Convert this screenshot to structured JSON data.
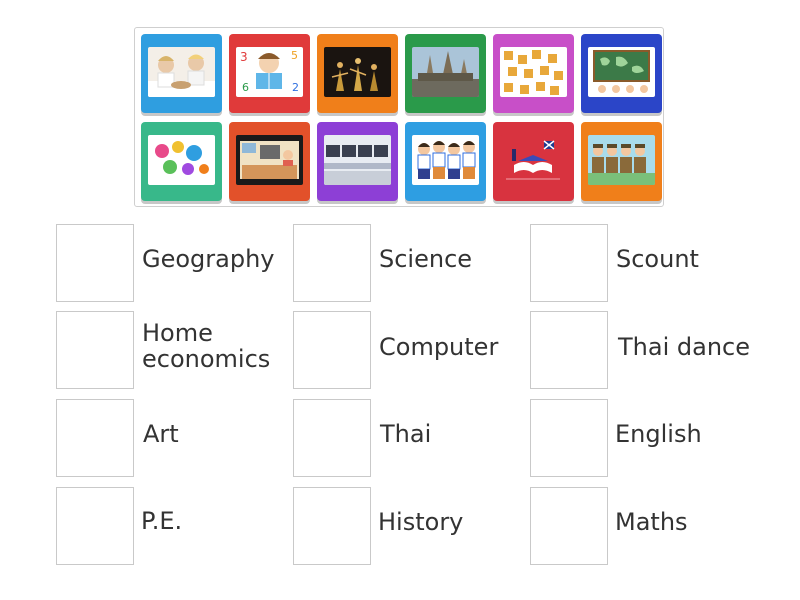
{
  "tiles": [
    {
      "icon": "children-cooking-icon",
      "color": "#2f9ee0"
    },
    {
      "icon": "child-reading-numbers-icon",
      "color": "#e03a3a"
    },
    {
      "icon": "thai-dancers-stage-icon",
      "color": "#f07f1a"
    },
    {
      "icon": "ancient-temple-ruins-icon",
      "color": "#2a9a4a"
    },
    {
      "icon": "scrabble-letters-icon",
      "color": "#c84fc8"
    },
    {
      "icon": "world-map-classroom-icon",
      "color": "#2b45c8"
    },
    {
      "icon": "paint-splash-icon",
      "color": "#38b88a"
    },
    {
      "icon": "kitchen-cartoon-icon",
      "color": "#e2512a"
    },
    {
      "icon": "computer-lab-icon",
      "color": "#8d3fd6"
    },
    {
      "icon": "thai-students-icon",
      "color": "#2e9ee2"
    },
    {
      "icon": "english-book-icon",
      "color": "#d8333f"
    },
    {
      "icon": "scouts-icon",
      "color": "#f07f1a"
    }
  ],
  "targets": [
    {
      "label": "Geography"
    },
    {
      "label": "Science"
    },
    {
      "label": "Scount"
    },
    {
      "label": "Home\neconomics"
    },
    {
      "label": "Computer"
    },
    {
      "label": "Thai dance"
    },
    {
      "label": "Art"
    },
    {
      "label": "Thai"
    },
    {
      "label": "English"
    },
    {
      "label": "P.E."
    },
    {
      "label": "History"
    },
    {
      "label": "Maths"
    }
  ]
}
